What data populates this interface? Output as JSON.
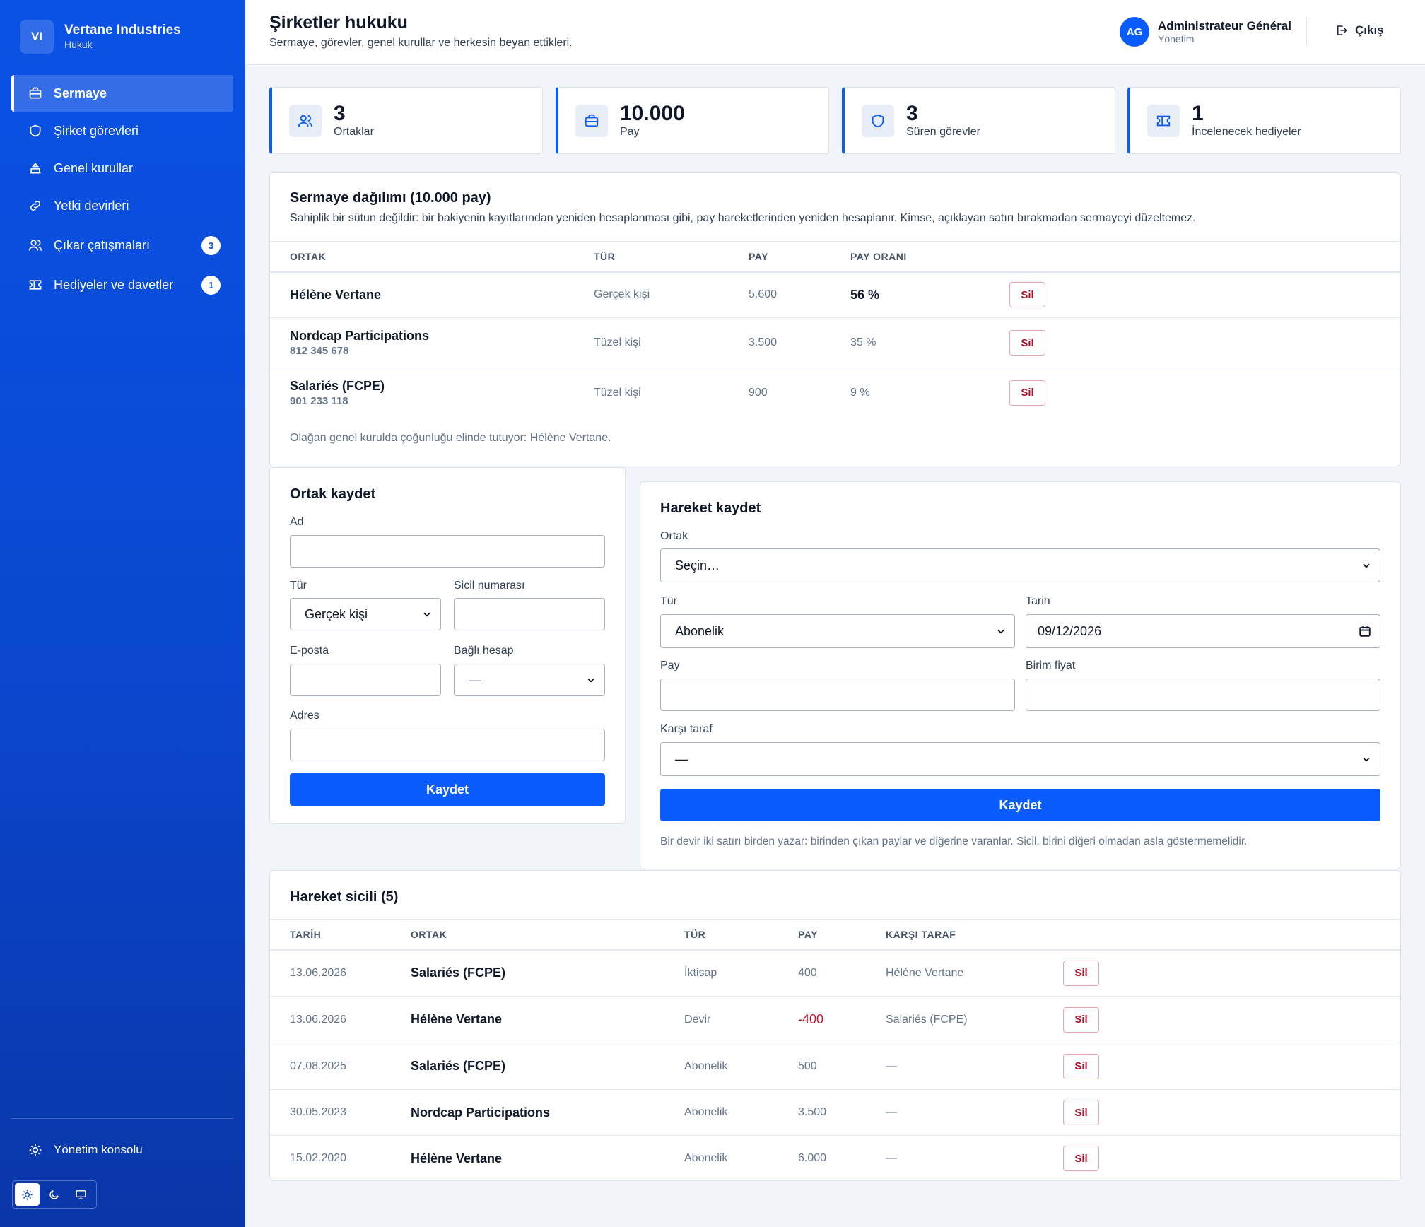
{
  "sidebar": {
    "brand_initials": "VI",
    "brand_name": "Vertane Industries",
    "brand_sub": "Hukuk",
    "items": [
      {
        "label": "Sermaye",
        "icon": "briefcase-icon"
      },
      {
        "label": "Şirket görevleri",
        "icon": "shield-icon"
      },
      {
        "label": "Genel kurullar",
        "icon": "assembly-icon"
      },
      {
        "label": "Yetki devirleri",
        "icon": "link-icon"
      },
      {
        "label": "Çıkar çatışmaları",
        "icon": "users-icon",
        "badge": "3"
      },
      {
        "label": "Hediyeler ve davetler",
        "icon": "ticket-icon",
        "badge": "1"
      }
    ],
    "console_label": "Yönetim konsolu"
  },
  "header": {
    "title": "Şirketler hukuku",
    "subtitle": "Sermaye, görevler, genel kurullar ve herkesin beyan ettikleri.",
    "user_initials": "AG",
    "user_name": "Administrateur Général",
    "user_role": "Yönetim",
    "logout_label": "Çıkış"
  },
  "stats": [
    {
      "value": "3",
      "label": "Ortaklar"
    },
    {
      "value": "10.000",
      "label": "Pay"
    },
    {
      "value": "3",
      "label": "Süren görevler"
    },
    {
      "value": "1",
      "label": "İncelenecek hediyeler"
    }
  ],
  "capital": {
    "title": "Sermaye dağılımı (10.000 pay)",
    "description": "Sahiplik bir sütun değildir: bir bakiyenin kayıtlarından yeniden hesaplanması gibi, pay hareketlerinden yeniden hesaplanır. Kimse, açıklayan satırı bırakmadan sermayeyi düzeltemez.",
    "columns": [
      "ORTAK",
      "TÜR",
      "PAY",
      "PAY ORANI"
    ],
    "rows": [
      {
        "name": "Hélène Vertane",
        "reg": "",
        "type": "Gerçek kişi",
        "shares": "5.600",
        "ratio": "56 %"
      },
      {
        "name": "Nordcap Participations",
        "reg": "812 345 678",
        "type": "Tüzel kişi",
        "shares": "3.500",
        "ratio": "35 %"
      },
      {
        "name": "Salariés (FCPE)",
        "reg": "901 233 118",
        "type": "Tüzel kişi",
        "shares": "900",
        "ratio": "9 %"
      }
    ],
    "delete_label": "Sil",
    "note": "Olağan genel kurulda çoğunluğu elinde tutuyor: Hélène Vertane."
  },
  "partner_form": {
    "title": "Ortak kaydet",
    "name_label": "Ad",
    "type_label": "Tür",
    "type_value": "Gerçek kişi",
    "reg_label": "Sicil numarası",
    "email_label": "E-posta",
    "account_label": "Bağlı hesap",
    "account_value": "—",
    "address_label": "Adres",
    "submit_label": "Kaydet"
  },
  "movement_form": {
    "title": "Hareket kaydet",
    "partner_label": "Ortak",
    "partner_value": "Seçin…",
    "type_label": "Tür",
    "type_value": "Abonelik",
    "date_label": "Tarih",
    "date_value": "09/12/2026",
    "shares_label": "Pay",
    "price_label": "Birim fiyat",
    "counterparty_label": "Karşı taraf",
    "counterparty_value": "—",
    "submit_label": "Kaydet",
    "note": "Bir devir iki satırı birden yazar: birinden çıkan paylar ve diğerine varanlar. Sicil, birini diğeri olmadan asla göstermemelidir."
  },
  "register": {
    "title": "Hareket sicili (5)",
    "columns": [
      "TARİH",
      "ORTAK",
      "TÜR",
      "PAY",
      "KARŞI TARAF"
    ],
    "rows": [
      {
        "date": "13.06.2026",
        "partner": "Salariés (FCPE)",
        "type": "İktisap",
        "shares": "400",
        "counterparty": "Hélène Vertane",
        "negative": false
      },
      {
        "date": "13.06.2026",
        "partner": "Hélène Vertane",
        "type": "Devir",
        "shares": "-400",
        "counterparty": "Salariés (FCPE)",
        "negative": true
      },
      {
        "date": "07.08.2025",
        "partner": "Salariés (FCPE)",
        "type": "Abonelik",
        "shares": "500",
        "counterparty": "—",
        "negative": false
      },
      {
        "date": "30.05.2023",
        "partner": "Nordcap Participations",
        "type": "Abonelik",
        "shares": "3.500",
        "counterparty": "—",
        "negative": false
      },
      {
        "date": "15.02.2020",
        "partner": "Hélène Vertane",
        "type": "Abonelik",
        "shares": "6.000",
        "counterparty": "—",
        "negative": false
      }
    ],
    "delete_label": "Sil"
  },
  "colors": {
    "accent": "#0b5cff",
    "sidebar": "#0b47cf",
    "danger": "#b0122b"
  }
}
